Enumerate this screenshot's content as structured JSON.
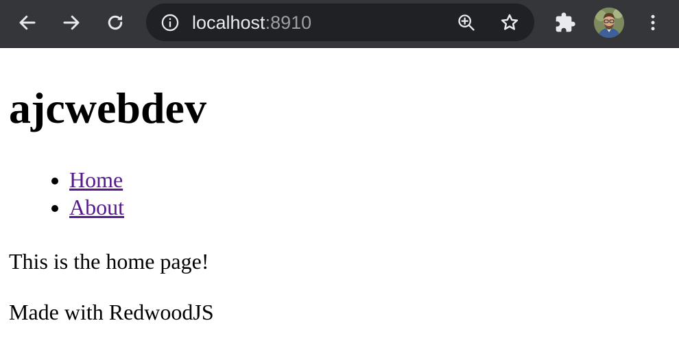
{
  "browser": {
    "url_host": "localhost",
    "url_port": ":8910",
    "icons": {
      "back": "arrow-left-icon",
      "forward": "arrow-right-icon",
      "reload": "reload-icon",
      "site_info": "info-icon",
      "zoom": "zoom-in-icon",
      "bookmark": "star-icon",
      "extensions": "puzzle-icon",
      "menu": "kebab-menu-icon"
    },
    "colors": {
      "toolbar": "#35363a",
      "omnibox": "#202124",
      "icon": "#e8eaed"
    }
  },
  "page": {
    "title": "ajcwebdev",
    "nav": [
      {
        "label": "Home"
      },
      {
        "label": "About"
      }
    ],
    "body_text": "This is the home page!",
    "footer_text": "Made with RedwoodJS",
    "colors": {
      "link": "#551a8b",
      "text": "#000000"
    }
  }
}
